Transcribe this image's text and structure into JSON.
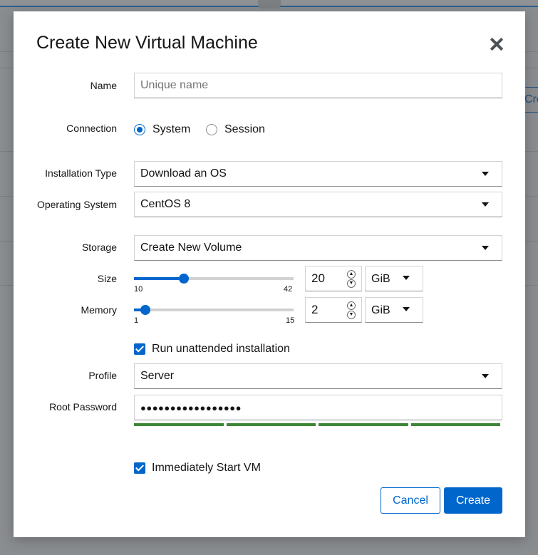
{
  "background": {
    "partial_button_label": "Cre"
  },
  "dialog": {
    "title": "Create New Virtual Machine",
    "close_icon": "close-icon"
  },
  "form": {
    "name": {
      "label": "Name",
      "placeholder": "Unique name",
      "value": ""
    },
    "connection": {
      "label": "Connection",
      "options": [
        {
          "label": "System",
          "selected": true
        },
        {
          "label": "Session",
          "selected": false
        }
      ]
    },
    "installation_type": {
      "label": "Installation Type",
      "value": "Download an OS"
    },
    "operating_system": {
      "label": "Operating System",
      "value": "CentOS 8"
    },
    "storage": {
      "label": "Storage",
      "value": "Create New Volume"
    },
    "size": {
      "label": "Size",
      "min": "10",
      "max": "42",
      "value": "20",
      "unit": "GiB",
      "fraction": 0.3125
    },
    "memory": {
      "label": "Memory",
      "min": "1",
      "max": "15",
      "value": "2",
      "unit": "GiB",
      "fraction": 0.0714
    },
    "unattended": {
      "label": "Run unattended installation",
      "checked": true
    },
    "profile": {
      "label": "Profile",
      "value": "Server"
    },
    "root_password": {
      "label": "Root Password",
      "value": "●●●●●●●●●●●●●●●●●",
      "strength_segments": 4
    },
    "start_vm": {
      "label": "Immediately Start VM",
      "checked": true
    }
  },
  "footer": {
    "cancel_label": "Cancel",
    "create_label": "Create"
  },
  "colors": {
    "primary": "#0066cc",
    "strength": "#3e8635",
    "overlay": "#8a8d90"
  }
}
